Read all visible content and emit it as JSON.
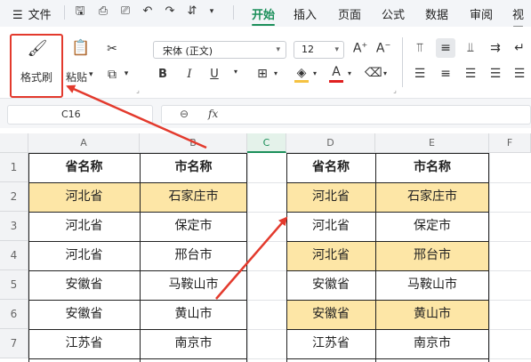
{
  "menu": {
    "file_label": "文件",
    "tabs": [
      {
        "label": "开始",
        "active": true
      },
      {
        "label": "插入"
      },
      {
        "label": "页面"
      },
      {
        "label": "公式"
      },
      {
        "label": "数据"
      },
      {
        "label": "审阅"
      },
      {
        "label": "视图"
      }
    ]
  },
  "ribbon": {
    "format_painter_label": "格式刷",
    "paste_label": "粘贴",
    "font_name": "宋体 (正文)",
    "font_size": "12",
    "bold": "B",
    "italic": "I",
    "underline": "U",
    "font_color_letter": "A",
    "grow_font": "A⁺",
    "shrink_font": "A⁻"
  },
  "formula_bar": {
    "name_box": "C16",
    "fx_label": "fx",
    "content": ""
  },
  "sheet": {
    "columns": [
      "A",
      "B",
      "C",
      "D",
      "E",
      "F"
    ],
    "selected_column": "C",
    "rows": [
      "1",
      "2",
      "3",
      "4",
      "5",
      "6",
      "7"
    ],
    "table_left": {
      "headers": [
        "省名称",
        "市名称"
      ],
      "rows": [
        {
          "province": "河北省",
          "city": "石家庄市",
          "highlight": true
        },
        {
          "province": "河北省",
          "city": "保定市",
          "highlight": false
        },
        {
          "province": "河北省",
          "city": "邢台市",
          "highlight": false
        },
        {
          "province": "安徽省",
          "city": "马鞍山市",
          "highlight": false
        },
        {
          "province": "安徽省",
          "city": "黄山市",
          "highlight": false
        },
        {
          "province": "江苏省",
          "city": "南京市",
          "highlight": false
        }
      ]
    },
    "table_right": {
      "headers": [
        "省名称",
        "市名称"
      ],
      "rows": [
        {
          "province": "河北省",
          "city": "石家庄市",
          "highlight": true
        },
        {
          "province": "河北省",
          "city": "保定市",
          "highlight": false
        },
        {
          "province": "河北省",
          "city": "邢台市",
          "highlight": true
        },
        {
          "province": "安徽省",
          "city": "马鞍山市",
          "highlight": false
        },
        {
          "province": "安徽省",
          "city": "黄山市",
          "highlight": true
        },
        {
          "province": "江苏省",
          "city": "南京市",
          "highlight": false
        }
      ]
    },
    "highlight_color": "#fde6a6",
    "annotation_color": "#e33a2d"
  }
}
